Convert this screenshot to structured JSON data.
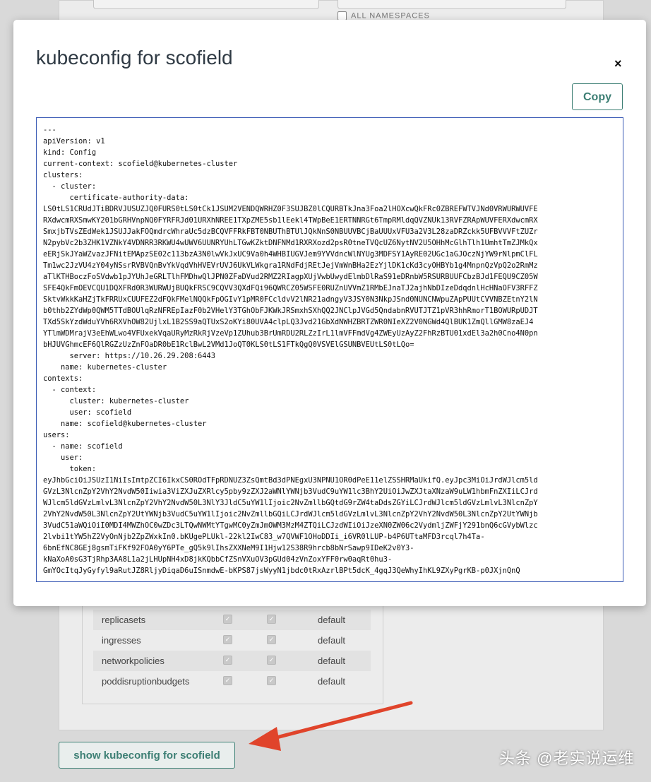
{
  "background": {
    "namespaces_label": "ALL NAMESPACES",
    "rows": [
      {
        "name": "replicasets",
        "namespace": "default"
      },
      {
        "name": "ingresses",
        "namespace": "default"
      },
      {
        "name": "networkpolicies",
        "namespace": "default"
      },
      {
        "name": "poddisruptionbudgets",
        "namespace": "default"
      }
    ],
    "show_button_label": "show kubeconfig for scofield",
    "watermark": "头条 @老实说运维"
  },
  "modal": {
    "title": "kubeconfig for scofield",
    "close_label": "×",
    "copy_label": "Copy",
    "lines": [
      "---",
      "apiVersion: v1",
      "kind: Config",
      "current-context: scofield@kubernetes-cluster",
      "clusters:",
      "  - cluster:",
      "      certificate-authority-data:",
      "LS0tLS1CRUdJTiBDRVJUSUZJQ0FURS0tLS0tCk1JSUM2VENDQWRHZ0F3SUJBZ0lCQURBTkJna3Foa2lHOXcwQkFRc0ZBREFWTVJNd0VRWURWUVFE",
      "RXdwcmRXSmwKY201bGRHVnpNQ0FYRFRJd01URXhNREE1TXpZME5sb1lEekl4TWpBeE1ERTNNRGt6TmpRMldqQVZNUk13RVFZRApWUVFERXdwcmRX",
      "SmxjbTVsZEdWek1JSUJJakFOQmdrcWhraUc5dzBCQVFFRkFBT0NBUThBTUlJQkNnS0NBUUVBCjBaUUUxVFU3a2V3L28zaDRZckk5UFBVVVFtZUZr",
      "N2pybVc2b3ZHK1VZNkY4VDNRR3RKWU4wUWV6UUNRYUhLTGwKZktDNFNMd1RXRXozd2psR0tneTVQcUZ6NytNV2U5OHhMcGlhTlh1UmhtTmZJMkQx",
      "eERjSkJYaWZvazJFNitEMApzSE02c113bzA3N0lwVkJxUC9Va0h4WHBIUGVJem9YVVdncWlNYUg3MDFSY1AyRE02UGc1aGJOczNjYW9rNlpmClFL",
      "Tm1wc2JzVU4zY04yNSsrRVBVQnBvYkVqdVhHVEVrUVJ6UkVLWkgra1RNdFdjREtJejVmWnBHa2EzYjlDK1cKd3cyOHBYb1g4MnpnQzVpQ2o2RmMz",
      "aTlKTHBoczFoSVdwb1pJYUhJeGRLTlhFMDhwQlJPN0ZFaDVud2RMZ2RIagpXUjVwbUwydElmbDlRaS91eDRnbW5RSURBUUFCbzBJd1FEQU9CZ05W",
      "SFE4QkFmOEVCQU1DQXFRd0R3WURWUjBUQkFRSC9CQVV3QXdFQi96QWRCZ05WSFE0RUZnUVVmZ1RMbEJnaTJ2ajhNbDIzeDdqdnlHcHNaOFV3RFFZ",
      "SktvWkkKaHZjTkFRRUxCUUFEZ2dFQkFMelNQQkFpOGIvY1pMR0FCcldvV2lNR21adngyV3JSY0N3NkpJSnd0NUNCNWpuZApPUUtCVVNBZEtnY2lN",
      "b0thb2ZYdWp0QWM5TTdBOUlqRzNFREpIazF0b2VHelY3TGhObFJKWkJRSmxhSXhQQ2JNClpJVGd5QndabnRVUTJTZ1pVR3hhRmorT1BOWURpUDJT",
      "TXd5SkYzdWduYVh6RXVhOW82UjlxL1B2SS9aQTUxS2oKYi80UVA4clpLQ3Jvd21GbXdNWHZBRTZWR0NIeXZ2V0NGWd4QlBUK1ZmQllGMW8zaEJ4",
      "YTlmWDMrajV3eEhWLwo4VFUxekVqaURyMzRkRjVzeVp1ZUhub3BrUmRDU2RLZzIrL1lmVFFmdVg4ZWEyUzAyZ2FhRzBTU01xdEl3a2h0Cno4N0pn",
      "bHJUVGhmcEF6QlRGZzUzZnFOaDR0bE1RclBwL2VMd1JoQT0KLS0tLS1FTkQgQ0VSVElGSUNBVEUtLS0tLQo=",
      "      server: https://10.26.29.208:6443",
      "    name: kubernetes-cluster",
      "contexts:",
      "  - context:",
      "      cluster: kubernetes-cluster",
      "      user: scofield",
      "    name: scofield@kubernetes-cluster",
      "users:",
      "  - name: scofield",
      "    user:",
      "      token:",
      "eyJhbGciOiJSUzI1NiIsImtpZCI6IkxCS0ROdTFpRDNUZ3ZsQmtBd3dPNEgxU3NPNU1OR0dPeE11elZSSHRMaUkifQ.eyJpc3MiOiJrdWJlcm5ld",
      "GVzL3NlcnZpY2VhY2NvdW50Iiwia3ViZXJuZXRlcy5pby9zZXJ2aWNlYWNjb3VudC9uYW1lc3BhY2UiOiJwZXJtaXNzaW9uLW1hbmFnZXIiLCJrd",
      "WJlcm5ldGVzLmlvL3NlcnZpY2VhY2NvdW50L3NlY3JldC5uYW1lIjoic2NvZmllbGQtdG9rZW4taDdsZGYiLCJrdWJlcm5ldGVzLmlvL3NlcnZpY",
      "2VhY2NvdW50L3NlcnZpY2UtYWNjb3VudC5uYW1lIjoic2NvZmllbGQiLCJrdWJlcm5ldGVzLmlvL3NlcnZpY2VhY2NvdW50L3NlcnZpY2UtYWNjb",
      "3VudC51aWQiOiI0MDI4MWZhOC0wZDc3LTQwNWMtYTgwMC0yZmJmOWM3MzM4ZTQiLCJzdWIiOiJzeXN0ZW06c2VydmljZWFjY291bnQ6cGVybWlzc",
      "2lvbi1tYW5hZ2VyOnNjb2ZpZWxkIn0.bKUgePLUkl-22kl2IwC83_w7QVWF1OHoDDIi_i6VR0lLUP-b4P6UTtaMFD3rcql7h4Ta-",
      "6bnEfNC8GEj8gsmTiFKf92FOA0yY6PTe_gQ5k9lIhsZXXNeM9I1Hjw12S38R9hrcb8bNrSawp9IDeK2v0Y3-",
      "kNaXoA0sG3TjRhp3AA8L1a2jLHUpNH4xD8jkKQbbCfZSnVXuOV3pGUd04zVnZoxYFF0rw0aqRt0hu3-",
      "GmYOcItqJyGyfyl9aRutJZ8RljyDiqaD6uISnmdwE-bKPS87jsWyyN1jbdc0tRxAzrlBPt5dcK_4gqJ3QeWhyIhKL9ZXyPgrKB-p0JXjnQnQ"
    ]
  }
}
